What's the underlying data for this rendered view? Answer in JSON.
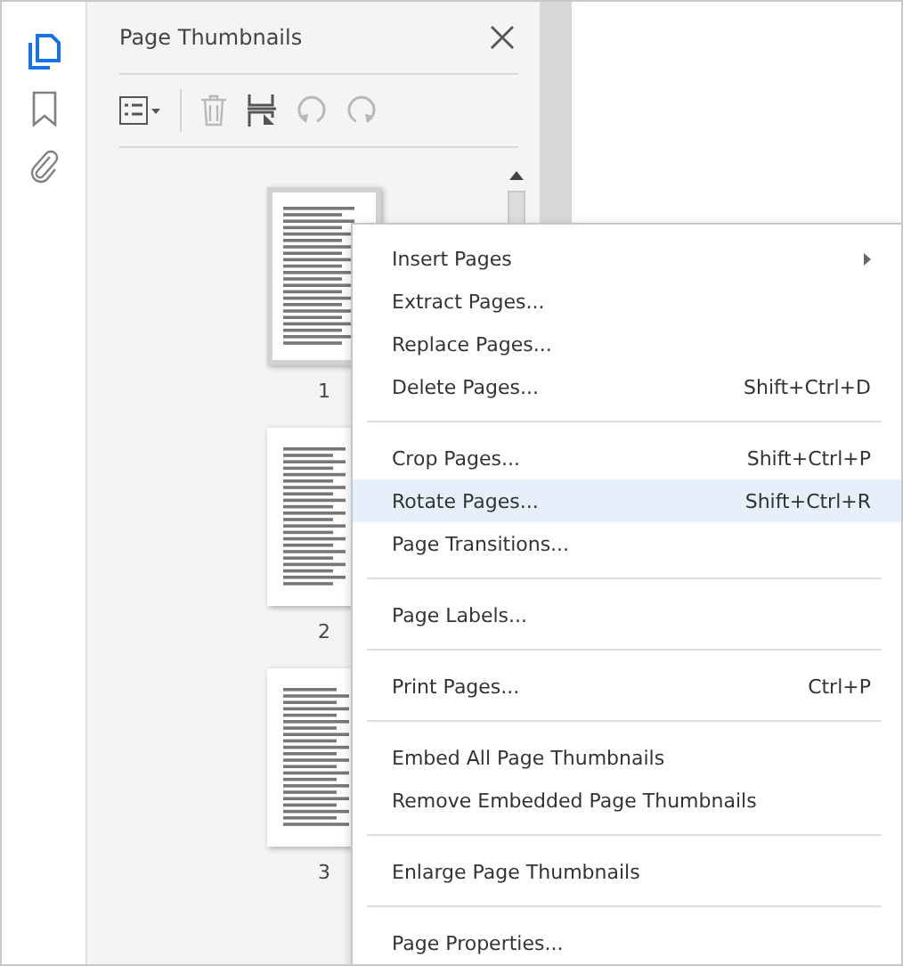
{
  "sidebar_tools": [
    {
      "kind": "pages",
      "selected": true
    },
    {
      "kind": "bookmark",
      "selected": false
    },
    {
      "kind": "attachment",
      "selected": false
    }
  ],
  "panel": {
    "title": "Page Thumbnails",
    "toolbar": [
      {
        "kind": "options",
        "disabled": false
      },
      {
        "kind": "trash",
        "disabled": true
      },
      {
        "kind": "crop",
        "disabled": false
      },
      {
        "kind": "rotate-left",
        "disabled": true
      },
      {
        "kind": "rotate-right",
        "disabled": true
      }
    ],
    "thumbnails": [
      {
        "label": "1",
        "selected": true
      },
      {
        "label": "2",
        "selected": false
      },
      {
        "label": "3",
        "selected": false
      }
    ]
  },
  "context_menu": [
    {
      "kind": "item",
      "label": "Insert Pages",
      "submenu": true,
      "selected": false
    },
    {
      "kind": "item",
      "label": "Extract Pages...",
      "selected": false
    },
    {
      "kind": "item",
      "label": "Replace Pages...",
      "selected": false
    },
    {
      "kind": "item",
      "label": "Delete Pages...",
      "shortcut": "Shift+Ctrl+D",
      "selected": false
    },
    {
      "kind": "separator"
    },
    {
      "kind": "item",
      "label": "Crop Pages...",
      "shortcut": "Shift+Ctrl+P",
      "selected": false
    },
    {
      "kind": "item",
      "label": "Rotate Pages...",
      "shortcut": "Shift+Ctrl+R",
      "selected": true
    },
    {
      "kind": "item",
      "label": "Page Transitions...",
      "selected": false
    },
    {
      "kind": "separator"
    },
    {
      "kind": "item",
      "label": "Page Labels...",
      "selected": false
    },
    {
      "kind": "separator"
    },
    {
      "kind": "item",
      "label": "Print Pages...",
      "shortcut": "Ctrl+P",
      "selected": false
    },
    {
      "kind": "separator"
    },
    {
      "kind": "item",
      "label": "Embed All Page Thumbnails",
      "selected": false
    },
    {
      "kind": "item",
      "label": "Remove Embedded Page Thumbnails",
      "selected": false
    },
    {
      "kind": "separator"
    },
    {
      "kind": "item",
      "label": "Enlarge Page Thumbnails",
      "selected": false
    },
    {
      "kind": "separator"
    },
    {
      "kind": "item",
      "label": "Page Properties...",
      "selected": false
    }
  ]
}
